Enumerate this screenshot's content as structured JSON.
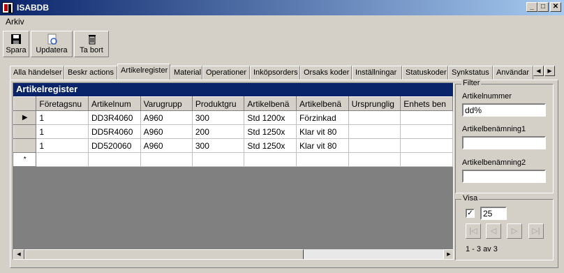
{
  "window": {
    "title": "ISABDB"
  },
  "menu": {
    "file": "Arkiv"
  },
  "toolbar": {
    "save": "Spara",
    "refresh": "Updatera",
    "delete": "Ta bort"
  },
  "tabs": [
    "Alla händelser",
    "Beskr actions",
    "Artikelregister",
    "Material",
    "Operationer",
    "Inköpsorders",
    "Orsaks koder",
    "Inställningar",
    "Statuskoder",
    "Synkstatus",
    "Användar"
  ],
  "grid": {
    "title": "Artikelregister",
    "columns": [
      "Företagsnu",
      "Artikelnum",
      "Varugrupp",
      "Produktgru",
      "Artikelbenä",
      "Artikelbenä",
      "Ursprunglig",
      "Enhets ben"
    ],
    "rows": [
      [
        "1",
        "DD3R4060",
        "A960",
        "300",
        "Std  1200x",
        "Förzinkad",
        "",
        ""
      ],
      [
        "1",
        "DD5R4060",
        "A960",
        "200",
        "Std  1250x",
        "Klar vit 80",
        "",
        ""
      ],
      [
        "1",
        "DD520060",
        "A960",
        "300",
        "Std  1250x",
        "Klar vit 80",
        "",
        ""
      ]
    ],
    "new_row_marker": "*"
  },
  "filter": {
    "legend": "Filter",
    "article_number_label": "Artikelnummer",
    "article_number_value": "dd%",
    "description1_label": "Artikelbenämning1",
    "description1_value": "",
    "description2_label": "Artikelbenämning2",
    "description2_value": ""
  },
  "show": {
    "legend": "Visa",
    "checked": true,
    "page_size": "25",
    "range_text": "1 - 3 av 3"
  }
}
